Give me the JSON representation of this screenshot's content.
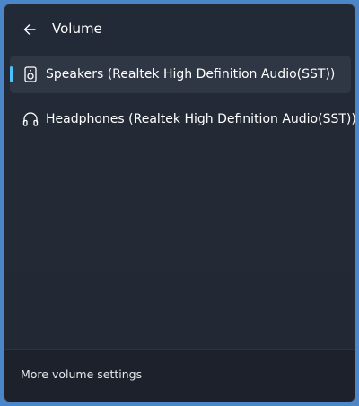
{
  "header": {
    "title": "Volume",
    "back_icon": "arrow-left-icon"
  },
  "devices": [
    {
      "label": "Speakers (Realtek High Definition Audio(SST))",
      "icon": "speaker-icon",
      "selected": true
    },
    {
      "label": "Headphones (Realtek High Definition Audio(SST))",
      "icon": "headphones-icon",
      "selected": false
    }
  ],
  "footer": {
    "more_settings_label": "More volume settings"
  },
  "colors": {
    "accent": "#4cc2ff",
    "panel_bg": "#232a37",
    "selected_bg": "#2f3644",
    "footer_bg": "#1c212b",
    "desktop_bg": "#4a86c8"
  }
}
